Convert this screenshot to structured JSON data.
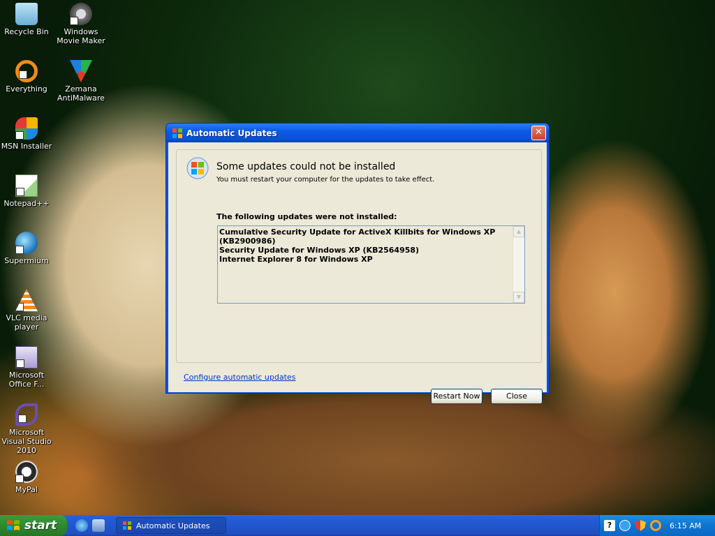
{
  "desktop_icons": [
    {
      "label": "Recycle Bin",
      "icon": "recycle-bin-icon"
    },
    {
      "label": "Windows Movie Maker",
      "icon": "movie-maker-icon"
    },
    {
      "label": "Everything",
      "icon": "everything-icon"
    },
    {
      "label": "Zemana AntiMalware",
      "icon": "zemana-icon"
    },
    {
      "label": "MSN Installer",
      "icon": "msn-icon"
    },
    {
      "label": "Notepad++",
      "icon": "notepad-icon"
    },
    {
      "label": "Supermium",
      "icon": "supermium-icon"
    },
    {
      "label": "VLC media player",
      "icon": "vlc-icon"
    },
    {
      "label": "Microsoft Office F...",
      "icon": "office-icon"
    },
    {
      "label": "Microsoft Visual Studio 2010",
      "icon": "visual-studio-icon"
    },
    {
      "label": "MyPal",
      "icon": "mypal-icon"
    }
  ],
  "window": {
    "title": "Automatic Updates",
    "heading": "Some updates could not be installed",
    "subheading": "You must restart your computer for the updates to take effect.",
    "list_label": "The following updates were not installed:",
    "failed_updates": [
      "Cumulative Security Update for ActiveX Killbits for Windows XP (KB2900986)",
      "Security Update for Windows XP (KB2564958)",
      "Internet Explorer 8 for Windows XP"
    ],
    "configure_link": "Configure automatic updates",
    "restart_label": "Restart Now",
    "close_label": "Close"
  },
  "taskbar": {
    "start_label": "start",
    "task_label": "Automatic Updates",
    "clock": "6:15 AM"
  },
  "colors": {
    "titlebar": "#0a5ae6",
    "taskbar": "#245edb",
    "start": "#2f8a2f",
    "link": "#0033cc"
  }
}
